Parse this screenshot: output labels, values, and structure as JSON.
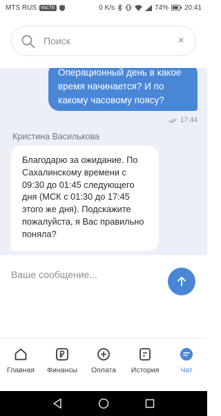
{
  "status_bar": {
    "carrier": "MTS RUS",
    "volte": "VoLTE",
    "network_speed": "0 K/s",
    "battery": "74%",
    "time": "20:41"
  },
  "search": {
    "placeholder": "Поиск",
    "clear": "×"
  },
  "chat": {
    "outgoing": {
      "text": "Операционный день в какое время начинается? И по какому часовому поясу?",
      "time": "17:44"
    },
    "incoming": {
      "sender": "Кристина Василькова",
      "text": "Благодарю за ожидание. По Сахалинскому времени с 09:30 до 01:45 следующего дня (МСК с 01:30 до 17:45 этого же дня). Подскажите пожалуйста, я Вас правильно поняла?"
    }
  },
  "composer": {
    "placeholder": "Ваше сообщение..."
  },
  "tabs": [
    {
      "label": "Главная",
      "icon": "home-icon"
    },
    {
      "label": "Финансы",
      "icon": "ruble-icon"
    },
    {
      "label": "Оплата",
      "icon": "plus-circle-icon"
    },
    {
      "label": "История",
      "icon": "history-icon"
    },
    {
      "label": "Чат",
      "icon": "chat-icon",
      "active": true
    }
  ],
  "colors": {
    "accent": "#4a86d6",
    "chat_background": "#eceff7"
  }
}
